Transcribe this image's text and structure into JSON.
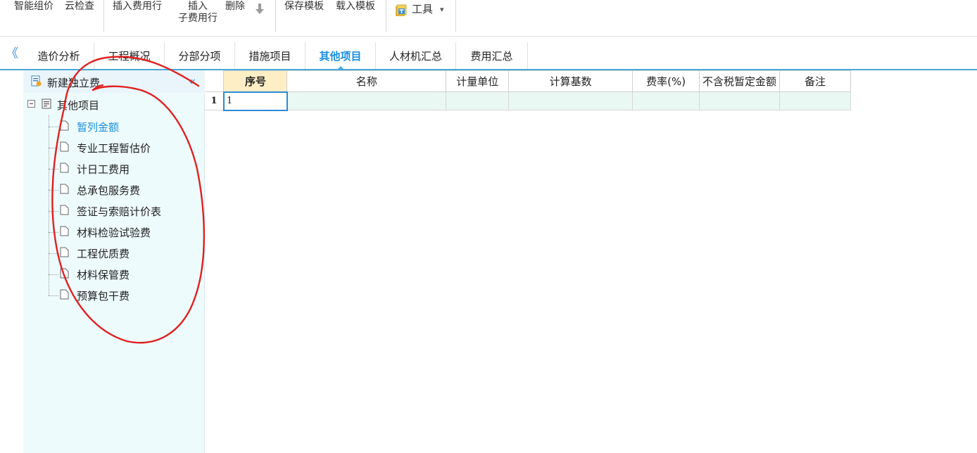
{
  "toolbar": {
    "smart_price": "智能组价",
    "cloud_check": "云检查",
    "insert_fee_row": "插入费用行",
    "insert_child_line1": "插入",
    "insert_child_line2": "子费用行",
    "delete": "删除",
    "save_template": "保存模板",
    "load_template": "载入模板",
    "tools": "工具",
    "tools_caret": "▾"
  },
  "tabs": [
    {
      "label": "造价分析"
    },
    {
      "label": "工程概况"
    },
    {
      "label": "分部分项"
    },
    {
      "label": "措施项目"
    },
    {
      "label": "其他项目"
    },
    {
      "label": "人材机汇总"
    },
    {
      "label": "费用汇总"
    }
  ],
  "active_tab": "其他项目",
  "sidebar": {
    "header": "新建独立费",
    "collapse_icon": "«",
    "root": "其他项目",
    "items": [
      {
        "label": "暂列金额"
      },
      {
        "label": "专业工程暂估价"
      },
      {
        "label": "计日工费用"
      },
      {
        "label": "总承包服务费"
      },
      {
        "label": "签证与索赔计价表"
      },
      {
        "label": "材料检验试验费"
      },
      {
        "label": "工程优质费"
      },
      {
        "label": "材料保管费"
      },
      {
        "label": "预算包干费"
      }
    ],
    "selected": "暂列金额"
  },
  "left_collapse_icon": "《",
  "grid": {
    "columns": [
      "序号",
      "名称",
      "计量单位",
      "计算基数",
      "费率(%)",
      "不含税暂定金额",
      "备注"
    ],
    "rows": [
      {
        "num": "1",
        "cells": [
          "1",
          "",
          "",
          "",
          "",
          "",
          ""
        ]
      }
    ]
  },
  "colors": {
    "accent": "#1b8fe0",
    "tab_underline": "#47a7d9",
    "header_highlight": "#fdeec6",
    "row_fill": "#eaf8f3",
    "sidebar_bg": "#eefbfd",
    "annotation": "#e02020"
  }
}
